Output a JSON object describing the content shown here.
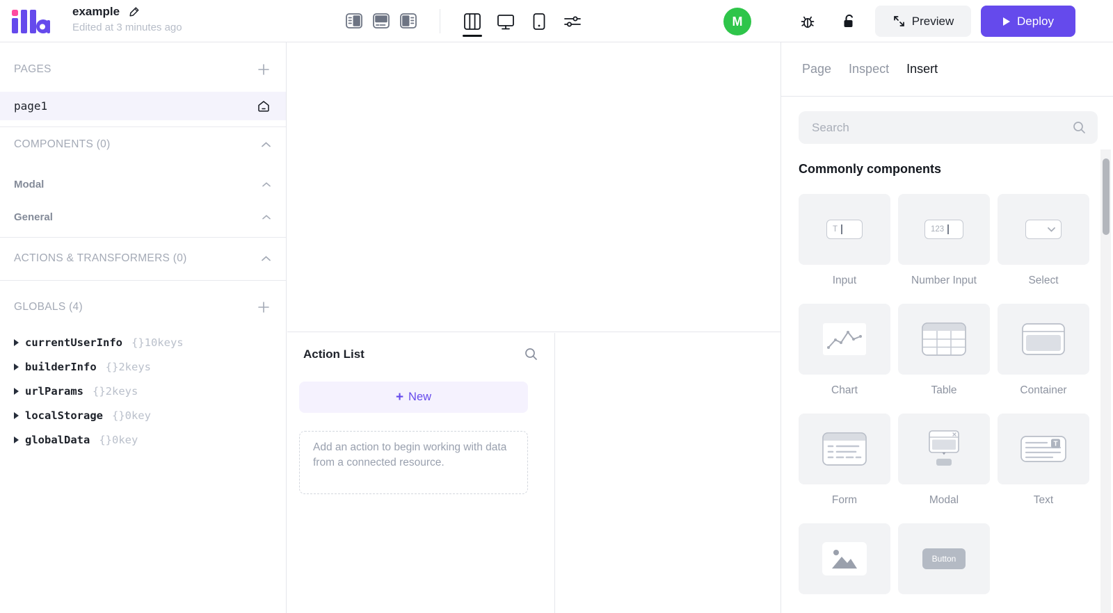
{
  "topbar": {
    "logo_text": "illa",
    "app_title": "example",
    "edited_status": "Edited at 3 minutes ago",
    "avatar_initial": "M",
    "preview_label": "Preview",
    "deploy_label": "Deploy"
  },
  "left_sidebar": {
    "pages_header": "PAGES",
    "pages": [
      {
        "name": "page1"
      }
    ],
    "components_header": "COMPONENTS (0)",
    "component_groups": [
      {
        "label": "Modal"
      },
      {
        "label": "General"
      }
    ],
    "actions_header": "ACTIONS & TRANSFORMERS (0)",
    "globals_header": "GLOBALS (4)",
    "globals": [
      {
        "name": "currentUserInfo",
        "meta": "{}10keys"
      },
      {
        "name": "builderInfo",
        "meta": "{}2keys"
      },
      {
        "name": "urlParams",
        "meta": "{}2keys"
      },
      {
        "name": "localStorage",
        "meta": "{}0key"
      },
      {
        "name": "globalData",
        "meta": "{}0key"
      }
    ]
  },
  "action_panel": {
    "title": "Action List",
    "new_plus": "+",
    "new_label": "New",
    "empty_hint": "Add an action to begin working with data from a connected resource."
  },
  "right_panel": {
    "tabs": [
      {
        "label": "Page"
      },
      {
        "label": "Inspect"
      },
      {
        "label": "Insert"
      }
    ],
    "search_placeholder": "Search",
    "section_title": "Commonly components",
    "components": [
      {
        "label": "Input"
      },
      {
        "label": "Number Input"
      },
      {
        "label": "Select"
      },
      {
        "label": "Chart"
      },
      {
        "label": "Table"
      },
      {
        "label": "Container"
      },
      {
        "label": "Form"
      },
      {
        "label": "Modal"
      },
      {
        "label": "Text"
      },
      {
        "label": ""
      },
      {
        "label": ""
      }
    ],
    "glyph_texts": {
      "input": "T",
      "number": "123",
      "button": "Button",
      "text_badge": "T"
    }
  },
  "colors": {
    "accent": "#654aec",
    "logo_pink": "#ff4aa1",
    "avatar_green": "#2ec54a",
    "border": "#e5e6eb"
  }
}
